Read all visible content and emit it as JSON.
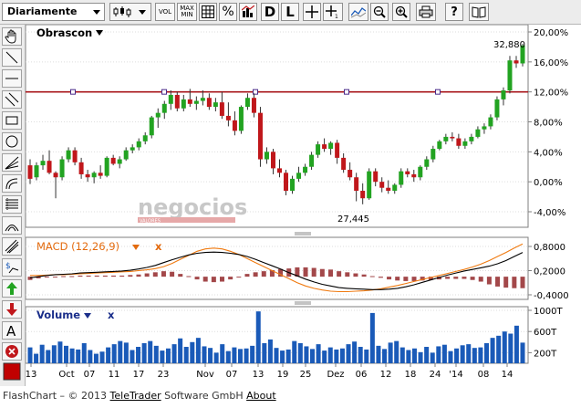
{
  "toolbar": {
    "period": "Diariamente",
    "buttons": [
      {
        "name": "chart-type-button",
        "label": ""
      },
      {
        "name": "volume-toggle-button",
        "label": "VOL"
      },
      {
        "name": "max-min-button",
        "label": "MAX\nMIN"
      },
      {
        "name": "grid-toggle-button",
        "label": ""
      },
      {
        "name": "percent-toggle-button",
        "label": "%"
      },
      {
        "name": "compare-button",
        "label": ""
      },
      {
        "name": "daily-scale-button",
        "label": "D"
      },
      {
        "name": "linear-scale-button",
        "label": "L"
      },
      {
        "name": "crosshair-button",
        "label": ""
      },
      {
        "name": "crosshair-label-button",
        "label": ""
      },
      {
        "name": "draw-line-button",
        "label": ""
      },
      {
        "name": "zoom-out-button",
        "label": ""
      },
      {
        "name": "zoom-in-button",
        "label": ""
      },
      {
        "name": "print-button",
        "label": ""
      },
      {
        "name": "help-button",
        "label": "?"
      },
      {
        "name": "manual-button",
        "label": ""
      }
    ]
  },
  "chart": {
    "instrument": "Obrascon",
    "watermark": "negocios",
    "watermark_sub": "VALORES",
    "annotation_high": "32,880",
    "annotation_low": "27,445",
    "y_ticks": [
      "20,00%",
      "16,00%",
      "12,00%",
      "8,00%",
      "4,00%",
      "0,00%",
      "-4,00%"
    ],
    "x_ticks": [
      "13",
      "Oct",
      "07",
      "11",
      "17",
      "23",
      "Nov",
      "07",
      "13",
      "19",
      "25",
      "Dez",
      "06",
      "12",
      "18",
      "24",
      "'14",
      "08",
      "14"
    ],
    "colors": {
      "up": "#22a321",
      "down": "#c0171b",
      "ref_line": "#a8161a",
      "macd": "#000000",
      "signal": "#f07a10",
      "hist": "#a3484a",
      "volume": "#1a5ab8"
    }
  },
  "macd": {
    "label": "MACD (12,26,9)",
    "close_symbol": "x",
    "y_ticks": [
      "0,8000",
      "0,2000",
      "-0,4000"
    ]
  },
  "volume": {
    "label": "Volume",
    "close_symbol": "x",
    "y_ticks": [
      "1000T",
      "600T",
      "200T"
    ]
  },
  "footer": {
    "prefix": "FlashChart – © 2013 ",
    "company": "TeleTrader",
    "middle": " Software GmbH ",
    "about": "About"
  },
  "chart_data": {
    "type": "candlestick",
    "title": "Obrascon",
    "yunit": "%",
    "ylim": [
      -5,
      21
    ],
    "ref_line": 12,
    "x_labels": [
      "13",
      "Oct",
      "07",
      "11",
      "17",
      "23",
      "Nov",
      "07",
      "13",
      "19",
      "25",
      "Dez",
      "06",
      "12",
      "18",
      "24",
      "'14",
      "08",
      "14"
    ],
    "ohlc": [
      {
        "o": 2.2,
        "h": 3.0,
        "l": -0.3,
        "c": 0.4
      },
      {
        "o": 0.6,
        "h": 2.6,
        "l": 0.2,
        "c": 2.2
      },
      {
        "o": 2.2,
        "h": 3.6,
        "l": 1.6,
        "c": 2.8
      },
      {
        "o": 2.8,
        "h": 4.2,
        "l": 1.0,
        "c": 1.2
      },
      {
        "o": 1.2,
        "h": 1.4,
        "l": -2.2,
        "c": 0.6
      },
      {
        "o": 0.6,
        "h": 3.4,
        "l": 0.2,
        "c": 3.0
      },
      {
        "o": 3.0,
        "h": 4.6,
        "l": 2.6,
        "c": 4.2
      },
      {
        "o": 4.2,
        "h": 4.6,
        "l": 2.2,
        "c": 2.6
      },
      {
        "o": 2.6,
        "h": 3.2,
        "l": 0.4,
        "c": 1.0
      },
      {
        "o": 1.0,
        "h": 1.6,
        "l": 0.0,
        "c": 0.6
      },
      {
        "o": 0.6,
        "h": 1.4,
        "l": -0.2,
        "c": 1.2
      },
      {
        "o": 1.2,
        "h": 2.2,
        "l": 0.4,
        "c": 0.8
      },
      {
        "o": 0.8,
        "h": 3.4,
        "l": 0.6,
        "c": 3.2
      },
      {
        "o": 3.2,
        "h": 3.6,
        "l": 2.2,
        "c": 2.4
      },
      {
        "o": 2.4,
        "h": 3.4,
        "l": 1.8,
        "c": 3.0
      },
      {
        "o": 3.0,
        "h": 4.6,
        "l": 2.8,
        "c": 4.2
      },
      {
        "o": 4.2,
        "h": 5.0,
        "l": 3.8,
        "c": 4.6
      },
      {
        "o": 4.6,
        "h": 5.8,
        "l": 4.2,
        "c": 5.4
      },
      {
        "o": 5.4,
        "h": 6.6,
        "l": 5.0,
        "c": 6.2
      },
      {
        "o": 6.2,
        "h": 8.8,
        "l": 5.8,
        "c": 8.6
      },
      {
        "o": 8.6,
        "h": 9.8,
        "l": 7.2,
        "c": 9.2
      },
      {
        "o": 9.2,
        "h": 10.8,
        "l": 8.4,
        "c": 10.4
      },
      {
        "o": 10.4,
        "h": 12.2,
        "l": 9.6,
        "c": 11.6
      },
      {
        "o": 11.6,
        "h": 12.0,
        "l": 9.4,
        "c": 9.8
      },
      {
        "o": 9.8,
        "h": 11.6,
        "l": 9.4,
        "c": 11.0
      },
      {
        "o": 11.0,
        "h": 12.4,
        "l": 10.0,
        "c": 10.4
      },
      {
        "o": 10.4,
        "h": 11.4,
        "l": 9.6,
        "c": 10.8
      },
      {
        "o": 10.8,
        "h": 12.2,
        "l": 10.2,
        "c": 11.2
      },
      {
        "o": 11.2,
        "h": 11.8,
        "l": 9.6,
        "c": 10.0
      },
      {
        "o": 10.0,
        "h": 11.2,
        "l": 9.4,
        "c": 10.6
      },
      {
        "o": 10.6,
        "h": 12.0,
        "l": 8.4,
        "c": 8.8
      },
      {
        "o": 8.8,
        "h": 10.6,
        "l": 7.4,
        "c": 8.2
      },
      {
        "o": 8.2,
        "h": 9.4,
        "l": 6.2,
        "c": 6.8
      },
      {
        "o": 6.8,
        "h": 10.2,
        "l": 6.4,
        "c": 10.0
      },
      {
        "o": 10.0,
        "h": 11.8,
        "l": 9.6,
        "c": 11.2
      },
      {
        "o": 11.2,
        "h": 11.8,
        "l": 8.6,
        "c": 9.2
      },
      {
        "o": 9.2,
        "h": 10.0,
        "l": 2.0,
        "c": 3.0
      },
      {
        "o": 3.0,
        "h": 4.6,
        "l": 2.4,
        "c": 4.0
      },
      {
        "o": 4.0,
        "h": 4.4,
        "l": 1.0,
        "c": 1.8
      },
      {
        "o": 1.8,
        "h": 3.0,
        "l": 0.6,
        "c": 1.2
      },
      {
        "o": 1.2,
        "h": 1.6,
        "l": -1.8,
        "c": -1.2
      },
      {
        "o": -1.2,
        "h": 0.8,
        "l": -1.6,
        "c": 0.4
      },
      {
        "o": 0.4,
        "h": 2.0,
        "l": 0.0,
        "c": 1.2
      },
      {
        "o": 1.2,
        "h": 2.4,
        "l": 0.8,
        "c": 2.0
      },
      {
        "o": 2.0,
        "h": 4.0,
        "l": 1.6,
        "c": 3.6
      },
      {
        "o": 3.6,
        "h": 5.4,
        "l": 3.2,
        "c": 5.0
      },
      {
        "o": 5.0,
        "h": 5.8,
        "l": 4.0,
        "c": 4.4
      },
      {
        "o": 4.4,
        "h": 5.4,
        "l": 3.6,
        "c": 5.2
      },
      {
        "o": 5.2,
        "h": 5.6,
        "l": 2.4,
        "c": 3.2
      },
      {
        "o": 3.2,
        "h": 3.8,
        "l": 1.2,
        "c": 1.6
      },
      {
        "o": 1.6,
        "h": 2.6,
        "l": 0.2,
        "c": 0.6
      },
      {
        "o": 0.6,
        "h": 1.2,
        "l": -2.6,
        "c": -1.2
      },
      {
        "o": -1.2,
        "h": -0.2,
        "l": -3.0,
        "c": -2.2
      },
      {
        "o": -2.2,
        "h": 1.8,
        "l": -2.4,
        "c": 1.4
      },
      {
        "o": 1.4,
        "h": 1.8,
        "l": -0.6,
        "c": 0.0
      },
      {
        "o": 0.0,
        "h": 0.6,
        "l": -1.4,
        "c": -0.8
      },
      {
        "o": -0.8,
        "h": 0.2,
        "l": -1.6,
        "c": -1.2
      },
      {
        "o": -1.2,
        "h": -0.2,
        "l": -1.6,
        "c": -0.4
      },
      {
        "o": -0.4,
        "h": 1.8,
        "l": -0.8,
        "c": 1.4
      },
      {
        "o": 1.4,
        "h": 1.8,
        "l": 0.6,
        "c": 1.0
      },
      {
        "o": 1.0,
        "h": 1.6,
        "l": 0.0,
        "c": 0.6
      },
      {
        "o": 0.6,
        "h": 2.2,
        "l": 0.2,
        "c": 2.0
      },
      {
        "o": 2.0,
        "h": 3.4,
        "l": 1.6,
        "c": 3.0
      },
      {
        "o": 3.0,
        "h": 4.8,
        "l": 2.6,
        "c": 4.4
      },
      {
        "o": 4.4,
        "h": 5.6,
        "l": 4.2,
        "c": 5.4
      },
      {
        "o": 5.4,
        "h": 6.4,
        "l": 5.0,
        "c": 6.0
      },
      {
        "o": 6.0,
        "h": 6.6,
        "l": 5.4,
        "c": 5.8
      },
      {
        "o": 5.8,
        "h": 6.4,
        "l": 4.4,
        "c": 4.8
      },
      {
        "o": 4.8,
        "h": 5.8,
        "l": 4.4,
        "c": 5.4
      },
      {
        "o": 5.4,
        "h": 6.4,
        "l": 5.0,
        "c": 6.0
      },
      {
        "o": 6.0,
        "h": 7.4,
        "l": 5.8,
        "c": 7.0
      },
      {
        "o": 7.0,
        "h": 7.8,
        "l": 6.4,
        "c": 7.4
      },
      {
        "o": 7.4,
        "h": 9.0,
        "l": 7.0,
        "c": 8.6
      },
      {
        "o": 8.6,
        "h": 11.4,
        "l": 8.2,
        "c": 11.0
      },
      {
        "o": 11.0,
        "h": 12.6,
        "l": 10.2,
        "c": 12.2
      },
      {
        "o": 12.2,
        "h": 16.8,
        "l": 11.8,
        "c": 16.2
      },
      {
        "o": 16.2,
        "h": 16.8,
        "l": 15.2,
        "c": 15.8
      },
      {
        "o": 15.8,
        "h": 18.4,
        "l": 15.4,
        "c": 18.2
      }
    ],
    "macd_series": [
      {
        "name": "MACD",
        "values": [
          0.02,
          0.05,
          0.08,
          0.1,
          0.11,
          0.12,
          0.14,
          0.15,
          0.16,
          0.17,
          0.18,
          0.19,
          0.21,
          0.24,
          0.28,
          0.33,
          0.4,
          0.47,
          0.53,
          0.59,
          0.63,
          0.65,
          0.66,
          0.65,
          0.63,
          0.6,
          0.55,
          0.48,
          0.4,
          0.32,
          0.24,
          0.15,
          0.07,
          -0.01,
          -0.08,
          -0.14,
          -0.18,
          -0.22,
          -0.24,
          -0.25,
          -0.26,
          -0.27,
          -0.27,
          -0.26,
          -0.24,
          -0.2,
          -0.15,
          -0.09,
          -0.03,
          0.03,
          0.09,
          0.14,
          0.19,
          0.23,
          0.27,
          0.31,
          0.37,
          0.45,
          0.55,
          0.65
        ]
      },
      {
        "name": "Signal",
        "values": [
          0.08,
          0.08,
          0.09,
          0.1,
          0.1,
          0.11,
          0.12,
          0.13,
          0.14,
          0.15,
          0.16,
          0.17,
          0.18,
          0.2,
          0.22,
          0.25,
          0.3,
          0.38,
          0.48,
          0.58,
          0.68,
          0.74,
          0.76,
          0.74,
          0.68,
          0.6,
          0.5,
          0.4,
          0.3,
          0.2,
          0.1,
          0.0,
          -0.1,
          -0.18,
          -0.24,
          -0.28,
          -0.31,
          -0.32,
          -0.32,
          -0.31,
          -0.3,
          -0.28,
          -0.25,
          -0.21,
          -0.17,
          -0.12,
          -0.07,
          -0.02,
          0.03,
          0.08,
          0.13,
          0.18,
          0.23,
          0.29,
          0.36,
          0.45,
          0.55,
          0.65,
          0.76,
          0.86
        ]
      }
    ],
    "volume_series": [
      {
        "name": "Volume",
        "values": [
          300,
          180,
          350,
          250,
          340,
          410,
          330,
          280,
          260,
          380,
          250,
          180,
          220,
          300,
          360,
          420,
          390,
          250,
          310,
          380,
          420,
          330,
          240,
          280,
          360,
          470,
          310,
          400,
          480,
          320,
          290,
          200,
          360,
          230,
          300,
          270,
          280,
          330,
          980,
          380,
          450,
          290,
          240,
          260,
          420,
          380,
          320,
          270,
          360,
          240,
          300,
          260,
          280,
          360,
          410,
          310,
          260,
          950,
          330,
          270,
          390,
          420,
          300,
          250,
          280,
          210,
          310,
          200,
          320,
          350,
          230,
          280,
          340,
          360,
          290,
          300,
          380,
          480,
          520,
          600,
          560,
          710,
          390
        ]
      }
    ]
  }
}
